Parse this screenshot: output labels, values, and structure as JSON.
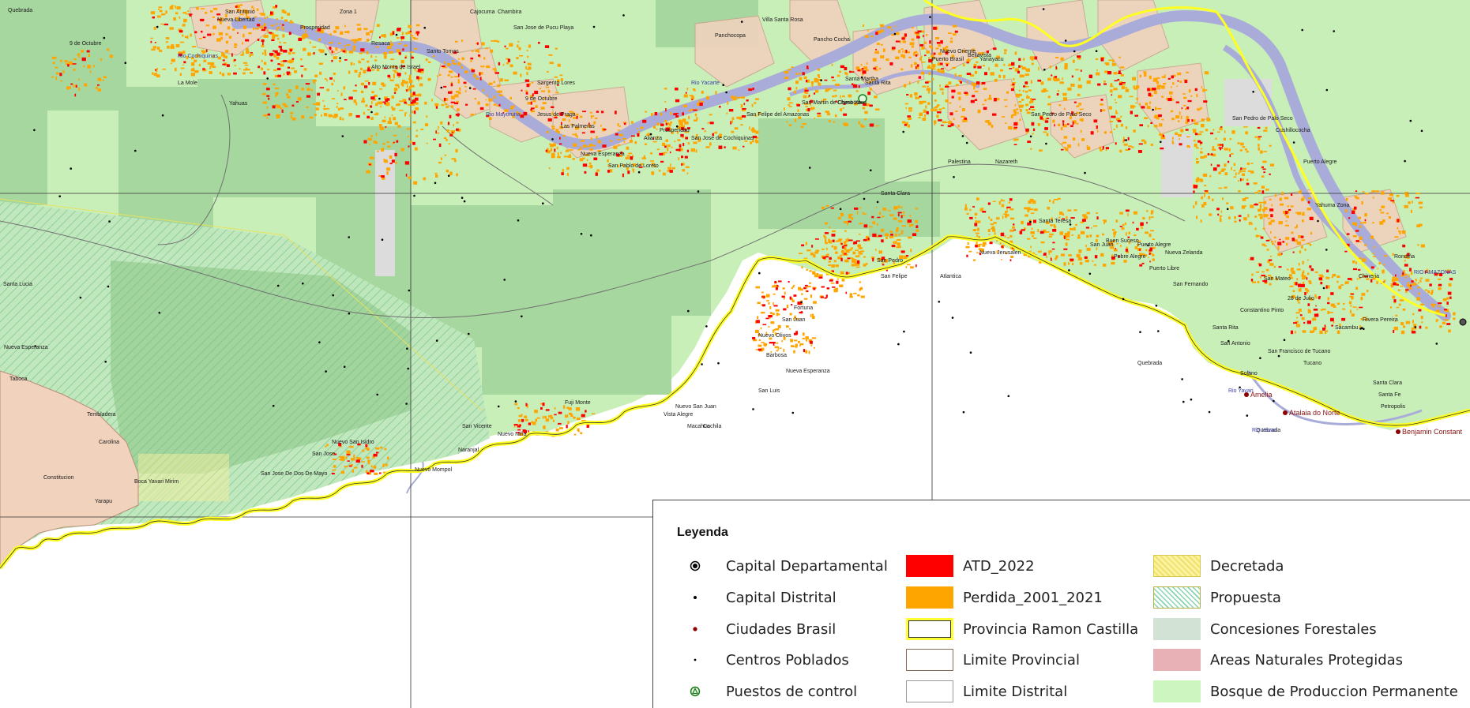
{
  "map": {
    "colors": {
      "bosque_produccion": "#c9efb9",
      "concesiones": "#a6d79e",
      "propuesta_hatch": "#7fcf93",
      "limite_provincial_fill": "#f0d2bd",
      "limite_provincial_line": "#b98f78",
      "river": "#a9acd8",
      "atd_2022": "#ff0000",
      "perdida": "#ffa500",
      "provincia_border": "#ffff22",
      "decretada": "#f2e98a",
      "anp": "#e8b1b5"
    },
    "places": [
      {
        "label": "9 de Octubre"
      },
      {
        "label": "Nueva Libertad"
      },
      {
        "label": "San Antonio"
      },
      {
        "label": "Zona 1"
      },
      {
        "label": "Prosperidad"
      },
      {
        "label": "Rio Cochiquinas"
      },
      {
        "label": "La Mole"
      },
      {
        "label": "Yahuas"
      },
      {
        "label": "Resaca"
      },
      {
        "label": "Alto Monte de Israel"
      },
      {
        "label": "Santo Tomas"
      },
      {
        "label": "Cajocuma"
      },
      {
        "label": "Chambira"
      },
      {
        "label": "San Jose de Pucu Playa"
      },
      {
        "label": "Sargento Lores"
      },
      {
        "label": "Rio Mayoruna"
      },
      {
        "label": "9 de Octubre"
      },
      {
        "label": "Jesus de Praga"
      },
      {
        "label": "Las Palmeras"
      },
      {
        "label": "Nueva Esperanza"
      },
      {
        "label": "San Pablo de Loreto"
      },
      {
        "label": "Panchocopa"
      },
      {
        "label": "Villa Santa Rosa"
      },
      {
        "label": "Pancho Cocha"
      },
      {
        "label": "Rio Yacarte"
      },
      {
        "label": "Santa Martha"
      },
      {
        "label": "San Martin de Chero Yacu"
      },
      {
        "label": "Chimbote"
      },
      {
        "label": "Santa Rita"
      },
      {
        "label": "San Felipe del Amazonas"
      },
      {
        "label": "Alianza"
      },
      {
        "label": "Prosperidad"
      },
      {
        "label": "San Jose de Cochiquinas"
      },
      {
        "label": "Santa Clara"
      },
      {
        "label": "San Pedro"
      },
      {
        "label": "San Felipe"
      },
      {
        "label": "Nuevo Oriente"
      },
      {
        "label": "Bellavista"
      },
      {
        "label": "Puerto Brasil"
      },
      {
        "label": "Yanayacu"
      },
      {
        "label": "San Pedro de Palo Seco"
      },
      {
        "label": "Palestina"
      },
      {
        "label": "Nazareth"
      },
      {
        "label": "Santa Teresa"
      },
      {
        "label": "Atlantica"
      },
      {
        "label": "Nueva Jerusalen"
      },
      {
        "label": "San Juan"
      },
      {
        "label": "Pobre Alegre"
      },
      {
        "label": "Buen Suceso"
      },
      {
        "label": "Puerto Alegre"
      },
      {
        "label": "Nueva Zelanda"
      },
      {
        "label": "Puerto Libre"
      },
      {
        "label": "San Fernando"
      },
      {
        "label": "San Pedro de Palo Seco"
      },
      {
        "label": "Cushillococha"
      },
      {
        "label": "Puerto Alegre"
      },
      {
        "label": "Yahuma Zona"
      },
      {
        "label": "Chineria"
      },
      {
        "label": "Rondiña"
      },
      {
        "label": "RIO AMAZONAS"
      },
      {
        "label": "Santa Rita"
      },
      {
        "label": "San Antonio"
      },
      {
        "label": "Solano"
      },
      {
        "label": "San Mateo"
      },
      {
        "label": "28 de Julio"
      },
      {
        "label": "Constantino Pinto"
      },
      {
        "label": "Sacambu"
      },
      {
        "label": "San Francisco de Tucano"
      },
      {
        "label": "Tucano"
      },
      {
        "label": "Rivera Pereira"
      },
      {
        "label": "Santa Clara"
      },
      {
        "label": "Santa Fe"
      },
      {
        "label": "Petropolis"
      },
      {
        "label": "Quebrada"
      },
      {
        "label": "Nuevo Olivos"
      },
      {
        "label": "San Juan"
      },
      {
        "label": "Barbosa"
      },
      {
        "label": "Nueva Esperanza"
      },
      {
        "label": "Fortuna"
      },
      {
        "label": "San Luis"
      },
      {
        "label": "Nuevo San Juan"
      },
      {
        "label": "Vista Alegre"
      },
      {
        "label": "Macahua"
      },
      {
        "label": "Cochila"
      },
      {
        "label": "Fuji Monte"
      },
      {
        "label": "San Vicente"
      },
      {
        "label": "Nuevo Niña"
      },
      {
        "label": "Naranjal"
      },
      {
        "label": "Nuevo San Isidro"
      },
      {
        "label": "San Jose"
      },
      {
        "label": "San Jose De Dos De Mayo"
      },
      {
        "label": "Boca Yavari Mirim"
      },
      {
        "label": "Yarapu"
      },
      {
        "label": "Constitucion"
      },
      {
        "label": "Carolina"
      },
      {
        "label": "Tembladera"
      },
      {
        "label": "Taboca"
      },
      {
        "label": "Nueva Esperanza"
      },
      {
        "label": "Santa Lucia"
      },
      {
        "label": "Nuevo Mompol"
      },
      {
        "label": "Quebrada"
      },
      {
        "label": "Rio Yavari"
      },
      {
        "label": "Rio Yavari"
      },
      {
        "label": "Quebrada"
      }
    ],
    "brazil_cities": [
      {
        "label": "Amelia"
      },
      {
        "label": "Atalaia do Norte"
      },
      {
        "label": "Benjamin Constant"
      }
    ]
  },
  "legend": {
    "title": "Leyenda",
    "col1": [
      {
        "label": "Capital Departamental",
        "icon": "capital-departamental-icon"
      },
      {
        "label": "Capital Distrital",
        "icon": "capital-distrital-icon"
      },
      {
        "label": "Ciudades Brasil",
        "icon": "ciudad-brasil-icon"
      },
      {
        "label": "Centros Poblados",
        "icon": "centro-poblado-icon"
      },
      {
        "label": "Puestos de control",
        "icon": "puesto-control-icon"
      }
    ],
    "col2": [
      {
        "label": "ATD_2022",
        "fill": "#ff0000",
        "border": "#ff0000"
      },
      {
        "label": "Perdida_2001_2021",
        "fill": "#ffa500",
        "border": "#ffa500"
      },
      {
        "label": "Provincia Ramon Castilla",
        "fill": "#ffffff",
        "border": "#e6e600"
      },
      {
        "label": "Limite Provincial",
        "fill": "#ffffff",
        "border": "#8a6a58"
      },
      {
        "label": "Limite Distrital",
        "fill": "#ffffff",
        "border": "#aaaaaa"
      }
    ],
    "col3": [
      {
        "label": "Decretada",
        "pattern": "decretada"
      },
      {
        "label": "Propuesta",
        "pattern": "propuesta"
      },
      {
        "label": "Concesiones Forestales",
        "fill": "#d2e2d4"
      },
      {
        "label": "Areas Naturales Protegidas",
        "fill": "#e8b1b5"
      },
      {
        "label": "Bosque de Produccion Permanente",
        "fill": "#cdf5c0"
      }
    ]
  }
}
